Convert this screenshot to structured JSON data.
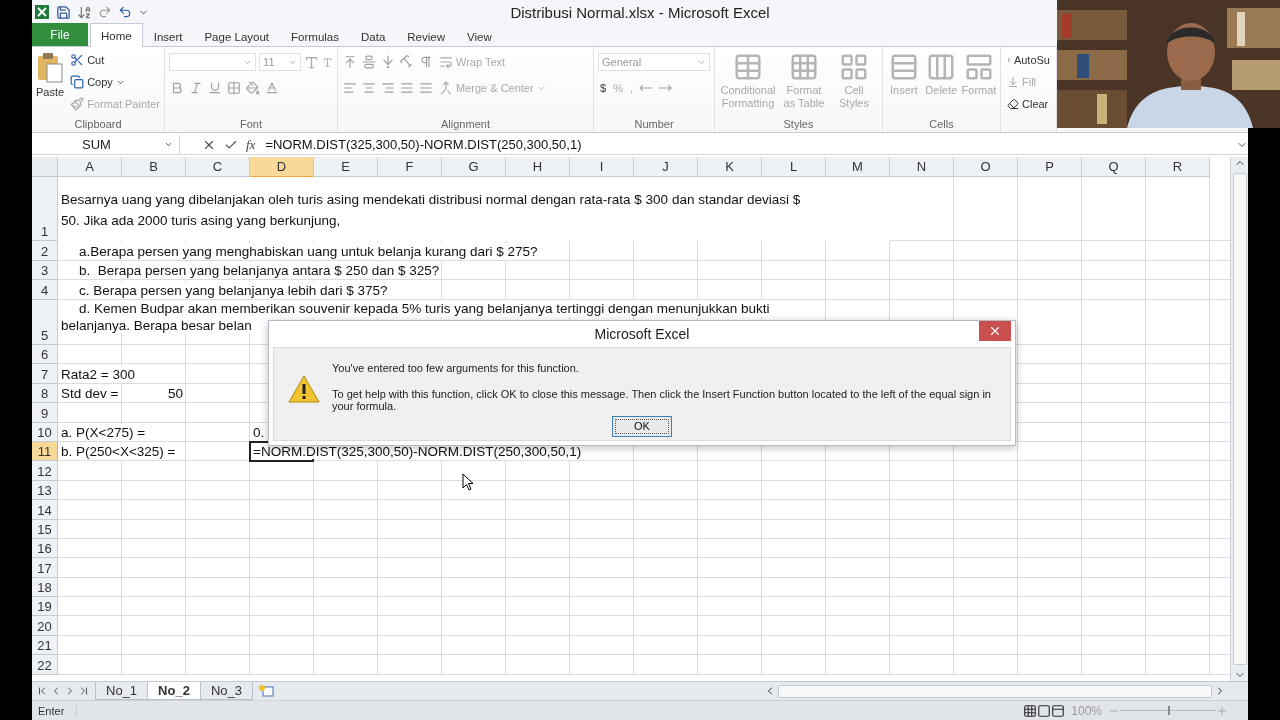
{
  "window": {
    "title": "Distribusi Normal.xlsx - Microsoft Excel"
  },
  "ribbon_tabs": [
    {
      "label": "File",
      "kind": "file",
      "selected": false
    },
    {
      "label": "Home",
      "kind": "tab",
      "selected": true
    },
    {
      "label": "Insert",
      "kind": "tab",
      "selected": false
    },
    {
      "label": "Page Layout",
      "kind": "tab",
      "selected": false
    },
    {
      "label": "Formulas",
      "kind": "tab",
      "selected": false
    },
    {
      "label": "Data",
      "kind": "tab",
      "selected": false
    },
    {
      "label": "Review",
      "kind": "tab",
      "selected": false
    },
    {
      "label": "View",
      "kind": "tab",
      "selected": false
    }
  ],
  "ribbon": {
    "clipboard": {
      "label": "Clipboard",
      "paste": "Paste",
      "cut": "Cut",
      "copy": "Copy",
      "format_painter": "Format Painter"
    },
    "font": {
      "label": "Font",
      "size": "11"
    },
    "alignment": {
      "label": "Alignment",
      "wrap_text": "Wrap Text",
      "merge_center": "Merge & Center"
    },
    "number": {
      "label": "Number",
      "format": "General",
      "currency": "$",
      "percent": "%",
      "comma": ","
    },
    "styles": {
      "label": "Styles",
      "buttons": [
        "Conditional Formatting",
        "Format as Table",
        "Cell Styles"
      ]
    },
    "cells": {
      "label": "Cells",
      "buttons": [
        "Insert",
        "Delete",
        "Format"
      ]
    },
    "editing": {
      "autosum": "AutoSu",
      "fill": "Fill",
      "clear": "Clear"
    }
  },
  "formula_bar": {
    "name_box": "SUM",
    "function_button": "fx",
    "formula": "=NORM.DIST(325,300,50)-NORM.DIST(250,300,50,1)"
  },
  "columns": [
    {
      "label": "A",
      "selected": false
    },
    {
      "label": "B",
      "selected": false
    },
    {
      "label": "C",
      "selected": false
    },
    {
      "label": "D",
      "selected": true
    },
    {
      "label": "E",
      "selected": false
    },
    {
      "label": "F",
      "selected": false
    },
    {
      "label": "G",
      "selected": false
    },
    {
      "label": "H",
      "selected": false
    },
    {
      "label": "I",
      "selected": false
    },
    {
      "label": "J",
      "selected": false
    },
    {
      "label": "K",
      "selected": false
    },
    {
      "label": "L",
      "selected": false
    },
    {
      "label": "M",
      "selected": false
    },
    {
      "label": "N",
      "selected": false
    },
    {
      "label": "O",
      "selected": false
    },
    {
      "label": "P",
      "selected": false
    },
    {
      "label": "Q",
      "selected": false
    },
    {
      "label": "R",
      "selected": false
    }
  ],
  "rows": [
    {
      "label": "1",
      "selected": false,
      "cells": [
        {
          "kind": "merged",
          "text": "Besarnya uang yang dibelanjakan oleh turis asing mendekati distribusi normal dengan rata-rata $ 300 dan standar deviasi $\n50. Jika ada 2000 turis asing yang berkunjung,"
        }
      ]
    },
    {
      "label": "2",
      "selected": false,
      "cells": [
        {
          "kind": "text",
          "indent": true,
          "text": "a.Berapa persen yang menghabiskan uang untuk belanja kurang dari $ 275?"
        }
      ]
    },
    {
      "label": "3",
      "selected": false,
      "cells": [
        {
          "kind": "text",
          "indent": true,
          "text": "b.  Berapa persen yang belanjanya antara $ 250 dan $ 325?"
        }
      ]
    },
    {
      "label": "4",
      "selected": false,
      "cells": [
        {
          "kind": "text",
          "indent": true,
          "text": "c. Berapa persen yang belanjanya lebih dari $ 375?"
        }
      ]
    },
    {
      "label": "5",
      "selected": false,
      "cells": [
        {
          "kind": "text",
          "indent": true,
          "text": "d. Kemen Budpar akan memberikan souvenir kepada 5% turis yang belanjanya tertinggi dengan menunjukkan bukti\nbelanjanya. Berapa besar belan"
        }
      ]
    },
    {
      "label": "6",
      "selected": false,
      "cells": []
    },
    {
      "label": "7",
      "selected": false,
      "cells": [
        {
          "kind": "text",
          "text": "Rata2 = 300"
        }
      ]
    },
    {
      "label": "8",
      "selected": false,
      "cells": [
        {
          "kind": "text",
          "text": "Std dev ="
        },
        {
          "kind": "number",
          "text": "50"
        }
      ]
    },
    {
      "label": "9",
      "selected": false,
      "cells": []
    },
    {
      "label": "10",
      "selected": false,
      "cells": [
        {
          "kind": "text",
          "text": "a. P(X<275) ="
        },
        null,
        null,
        {
          "kind": "text",
          "text": "0."
        }
      ]
    },
    {
      "label": "11",
      "selected": true,
      "cells": [
        {
          "kind": "text",
          "text": "b. P(250<X<325) ="
        },
        null,
        null,
        {
          "kind": "editing",
          "text": "=NORM.DIST(325,300,50)-NORM.DIST(250,300,50,1)"
        }
      ]
    },
    {
      "label": "12",
      "selected": false,
      "cells": []
    },
    {
      "label": "13",
      "selected": false,
      "cells": []
    },
    {
      "label": "14",
      "selected": false,
      "cells": []
    },
    {
      "label": "15",
      "selected": false,
      "cells": []
    },
    {
      "label": "16",
      "selected": false,
      "cells": []
    },
    {
      "label": "17",
      "selected": false,
      "cells": []
    },
    {
      "label": "18",
      "selected": false,
      "cells": []
    },
    {
      "label": "19",
      "selected": false,
      "cells": []
    },
    {
      "label": "20",
      "selected": false,
      "cells": []
    },
    {
      "label": "21",
      "selected": false,
      "cells": []
    },
    {
      "label": "22",
      "selected": false,
      "cells": []
    }
  ],
  "sheet_tabs": [
    {
      "label": "No_1",
      "selected": false
    },
    {
      "label": "No_2",
      "selected": true
    },
    {
      "label": "No_3",
      "selected": false
    }
  ],
  "status_bar": {
    "mode": "Enter",
    "zoom": {
      "reading": "100%",
      "level": 0.5
    }
  },
  "dialog": {
    "title": "Microsoft Excel",
    "message": "You've entered too few arguments for this function.",
    "help": "To get help with this function, click OK to close this message. Then click the Insert Function button located to the left of the equal sign in your formula.",
    "button": "OK"
  }
}
